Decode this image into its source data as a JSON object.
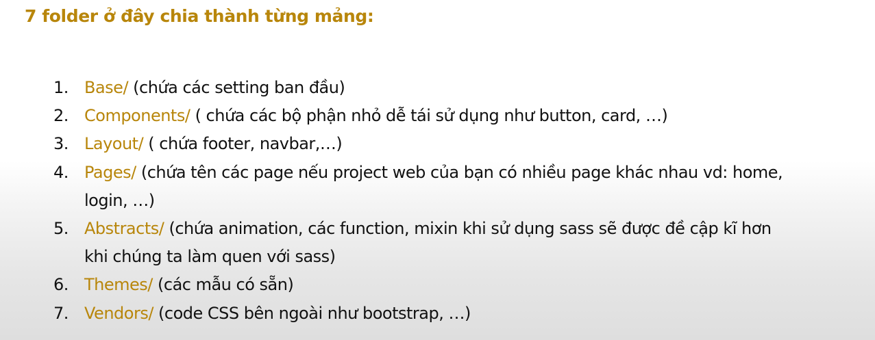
{
  "heading": "7 folder ở đây chia thành từng mảng:",
  "items": [
    {
      "number": "1.",
      "folder": "Base/",
      "description": " (chứa các setting ban đầu)"
    },
    {
      "number": "2.",
      "folder": "Components/",
      "description": " ( chứa các bộ phận nhỏ dễ tái sử dụng như button, card, …)"
    },
    {
      "number": "3.",
      "folder": "Layout/",
      "description": " ( chứa footer, navbar,…)"
    },
    {
      "number": "4.",
      "folder": "Pages/",
      "description": " (chứa tên các page nếu project web của bạn có nhiều page khác nhau vd: home, login, …)"
    },
    {
      "number": "5.",
      "folder": "Abstracts/",
      "description": " (chứa animation, các function, mixin khi sử dụng sass sẽ được đề cập kĩ hơn khi chúng ta làm quen với sass)"
    },
    {
      "number": "6.",
      "folder": "Themes/",
      "description": " (các mẫu có sẵn)"
    },
    {
      "number": "7.",
      "folder": "Vendors/",
      "description": " (code CSS bên ngoài như bootstrap, …)"
    }
  ],
  "colors": {
    "accent": "#b8860b",
    "text": "#111111"
  }
}
